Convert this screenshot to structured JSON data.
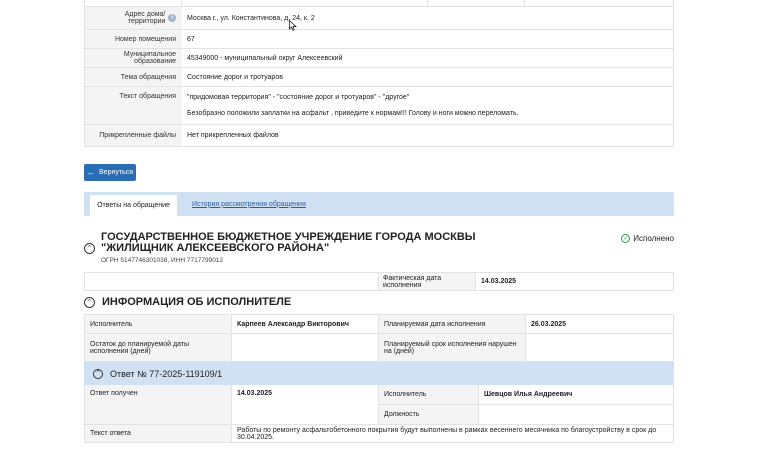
{
  "details": [
    {
      "label": "Адрес дома/территории",
      "value": "Москва г., ул. Константинова, д. 24, к. 2",
      "info": true
    },
    {
      "label": "Номер помещения",
      "value": "67"
    },
    {
      "label": "Муниципальное образование",
      "value": "45349000 - муниципальный округ Алексеевский"
    },
    {
      "label": "Тема обращения",
      "value": "Состояние дорог и тротуаров"
    },
    {
      "label": "Текст обращения",
      "value": "\"придомовая территория\" - \"состояние дорог и тротуаров\" - \"другое\"",
      "value2": "Безобразно положили заплатки на асфальт , приведите к нормам!!! Голову и ноги можно переломать."
    },
    {
      "label": "Прикрепленные файлы",
      "value": "Нет прикрепленных файлов"
    }
  ],
  "back_button": {
    "label": "Вернуться"
  },
  "tabs": {
    "active": "Ответы на обращение",
    "link": "История рассмотрения обращения"
  },
  "organization": {
    "title": "ГОСУДАРСТВЕННОЕ БЮДЖЕТНОЕ УЧРЕЖДЕНИЕ ГОРОДА МОСКВЫ \"ЖИЛИЩНИК АЛЕКСЕЕВСКОГО РАЙОНА\"",
    "ids": "ОГРН 5147746301038, ИНН 7717799012",
    "status": "Исполнено"
  },
  "fact_date": {
    "label": "Фактическая дата исполнения",
    "value": "14.03.2025"
  },
  "executor_section": {
    "title": "ИНФОРМАЦИЯ ОБ ИСПОЛНИТЕЛЕ",
    "row1": {
      "l1": "Исполнитель",
      "v1": "Карпеев Александр Викторович",
      "l2": "Планируемая дата исполнения",
      "v2": "26.03.2025"
    },
    "row2": {
      "l1": "Остаток до планируемой даты исполнения (дней)",
      "v1": "",
      "l2": "Планируемый срок исполнения нарушен на (дней)",
      "v2": ""
    }
  },
  "answer": {
    "title": "Ответ № 77-2025-119109/1",
    "received_label": "Ответ получен",
    "received_value": "14.03.2025",
    "executor_label": "Исполнитель",
    "executor_value": "Шевцов Илья Андреевич",
    "position_label": "Должность",
    "position_value": "",
    "text_label": "Текст ответа",
    "text_value": "Работы по ремонту асфальтобетонного покрытия будут выполнены в рамках весеннего месячника по благоустройству в срок до 30.04.2025."
  }
}
